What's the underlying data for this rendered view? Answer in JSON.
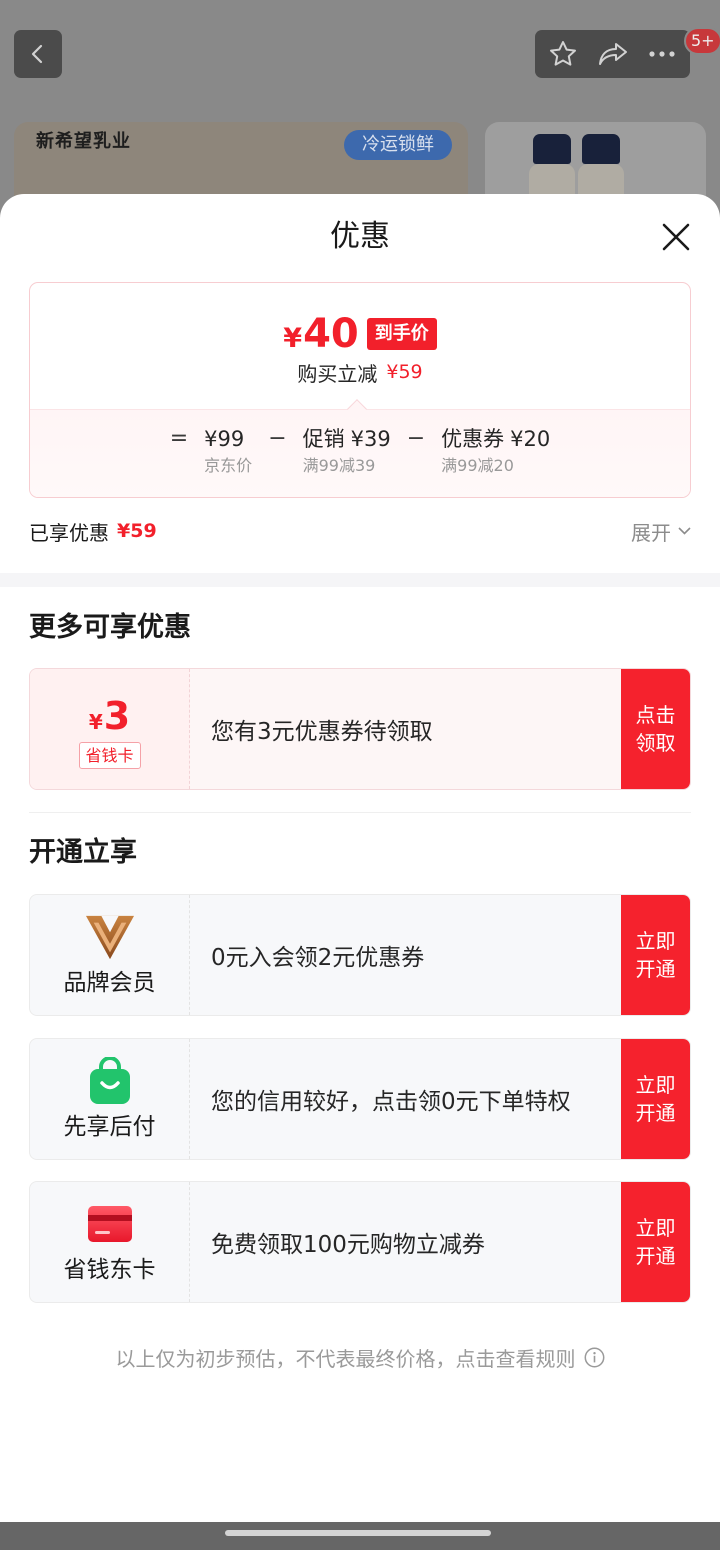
{
  "top_bar": {
    "back_icon": "chevron-left-icon",
    "action_icons": [
      "star-icon",
      "share-icon",
      "more-icon"
    ],
    "badge": "5+"
  },
  "product_preview": {
    "brand_logo": "新希望乳业",
    "cold_chain_tag": "冷运锁鲜"
  },
  "sheet": {
    "title": "优惠",
    "close_icon": "close-icon"
  },
  "price_summary": {
    "final_currency": "¥",
    "final_amount": "40",
    "final_tag": "到手价",
    "reduction_label": "购买立减",
    "reduction_amount": "¥59",
    "equals_sign": "=",
    "minus_sign": "−",
    "breakdown": [
      {
        "amount": "¥99",
        "note": "京东价"
      },
      {
        "name": "促销",
        "amount": "¥39",
        "note": "满99减39"
      },
      {
        "name": "优惠券",
        "amount": "¥20",
        "note": "满99减20"
      }
    ]
  },
  "enjoyed": {
    "label": "已享优惠",
    "amount": "¥59",
    "expand_label": "展开",
    "expand_icon": "chevron-down-icon"
  },
  "more_offers": {
    "heading": "更多可享优惠",
    "card": {
      "currency": "¥",
      "value": "3",
      "tag": "省钱卡",
      "description": "您有3元优惠券待领取",
      "button_lines": [
        "点击",
        "领取"
      ]
    }
  },
  "open_benefits": {
    "heading": "开通立享",
    "items": [
      {
        "icon": "brand-member-v-icon",
        "label": "品牌会员",
        "description": "0元入会领2元优惠券",
        "button_lines": [
          "立即",
          "开通"
        ]
      },
      {
        "icon": "shopping-bag-icon",
        "label": "先享后付",
        "description": "您的信用较好，点击领0元下单特权",
        "button_lines": [
          "立即",
          "开通"
        ]
      },
      {
        "icon": "red-card-icon",
        "label": "省钱东卡",
        "description": "免费领取100元购物立减券",
        "button_lines": [
          "立即",
          "开通"
        ]
      }
    ]
  },
  "footer": {
    "note": "以上仅为初步预估，不代表最终价格，点击查看规则",
    "info_icon": "info-icon"
  },
  "colors": {
    "accent_red": "#f5222d",
    "price_red": "#f2202b",
    "member_gold": "#b8702f",
    "pay_later_green": "#22c46c"
  }
}
